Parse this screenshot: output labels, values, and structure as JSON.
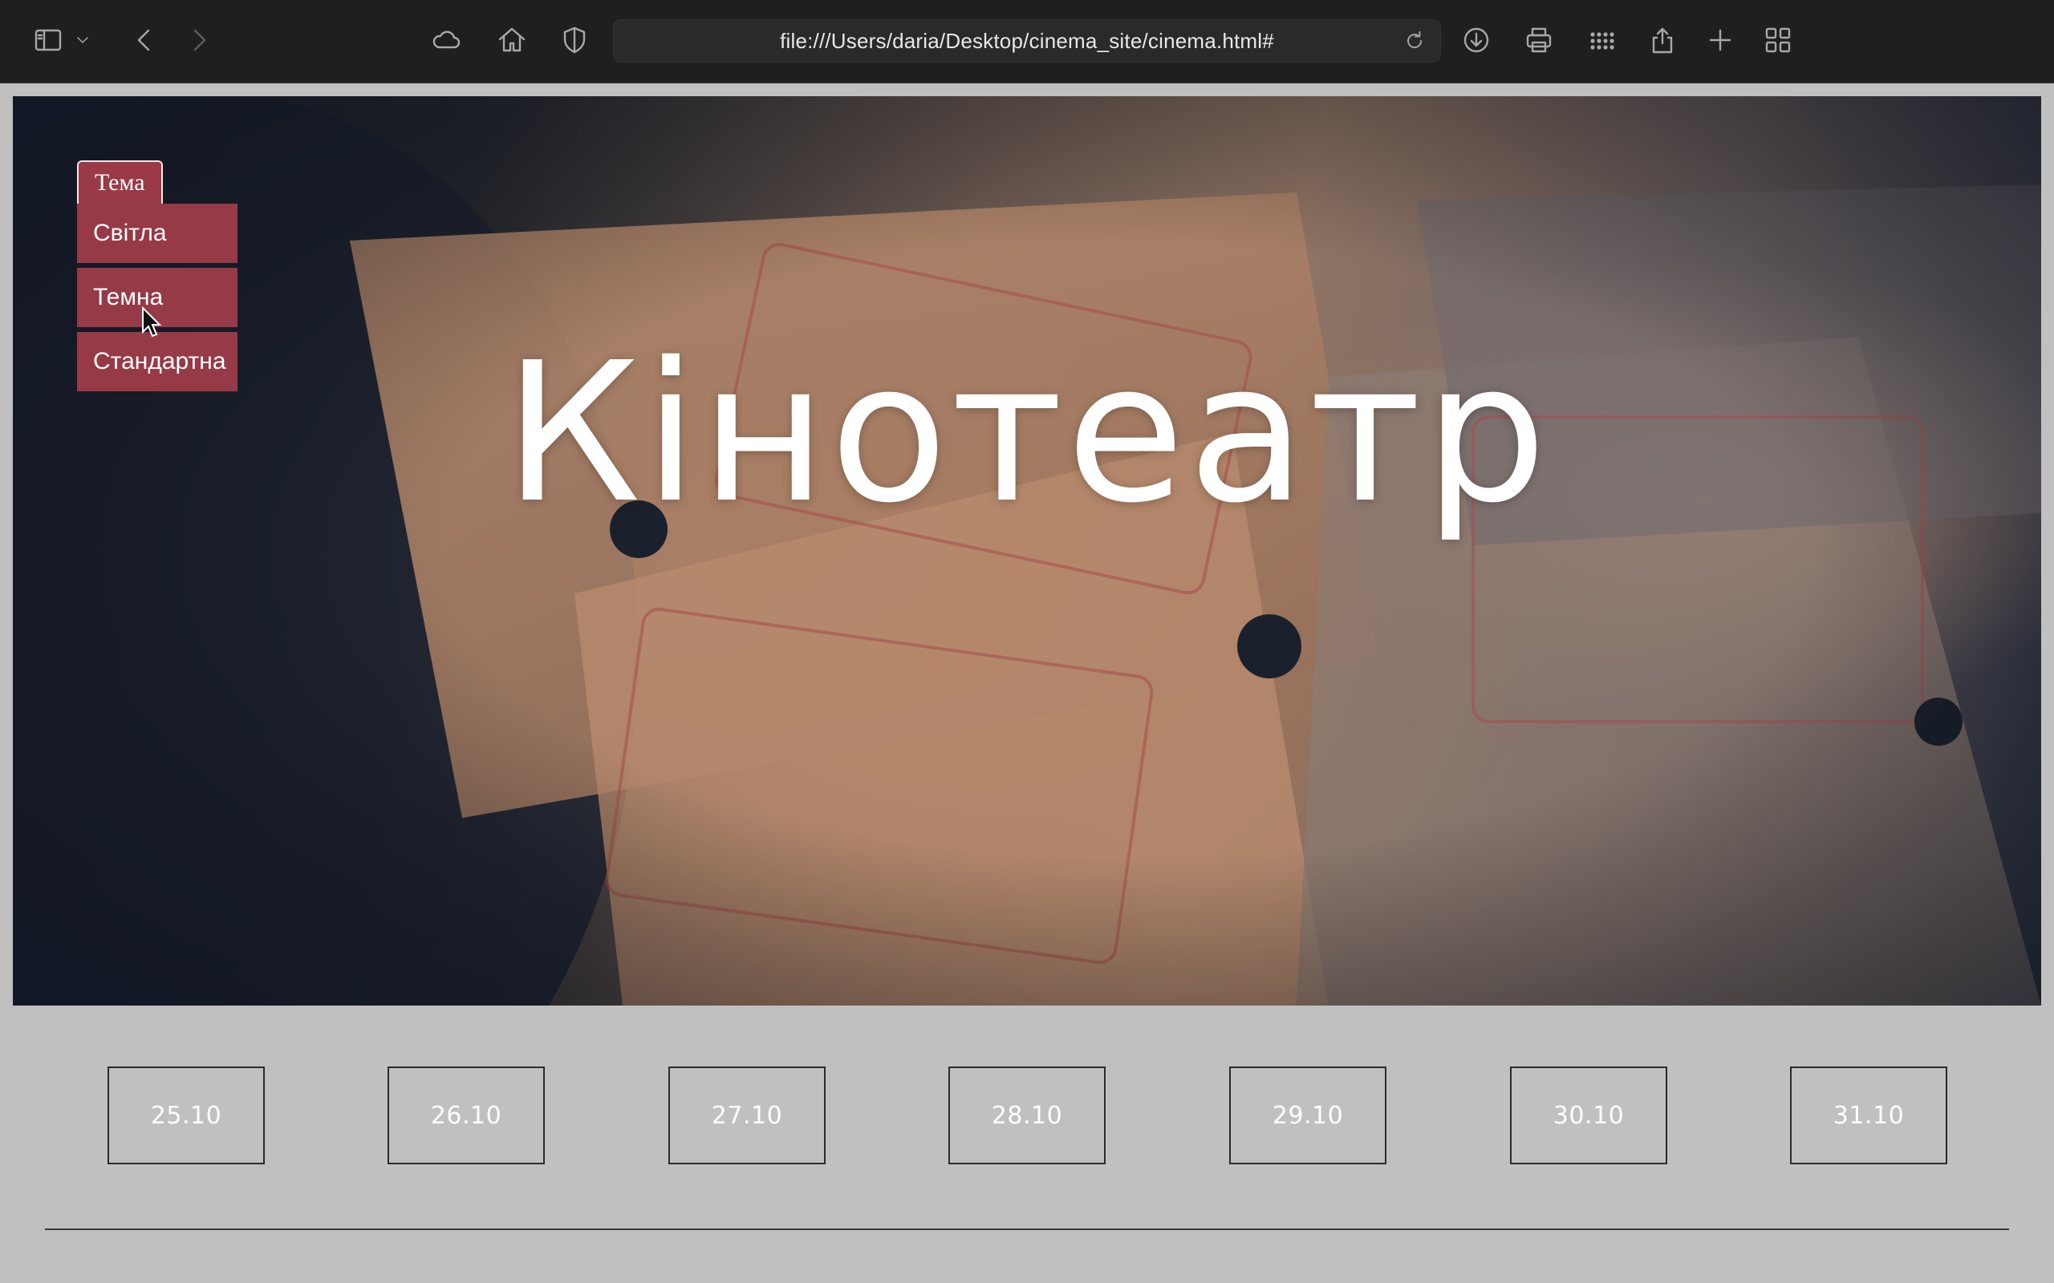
{
  "browser": {
    "url": "file:///Users/daria/Desktop/cinema_site/cinema.html#",
    "icons": [
      "sidebar-icon",
      "chevron-down-icon",
      "back-icon",
      "forward-icon",
      "cloud-icon",
      "home-icon",
      "shield-icon",
      "reload-icon",
      "download-icon",
      "printer-icon",
      "grid-apps-icon",
      "share-icon",
      "new-tab-icon",
      "tab-overview-icon"
    ]
  },
  "hero": {
    "title": "Кінотеатр"
  },
  "theme": {
    "label": "Тема",
    "options": [
      "Світла",
      "Темна",
      "Стандартна"
    ],
    "accent": "#963a47"
  },
  "dates": [
    "25.10",
    "26.10",
    "27.10",
    "28.10",
    "29.10",
    "30.10",
    "31.10"
  ]
}
